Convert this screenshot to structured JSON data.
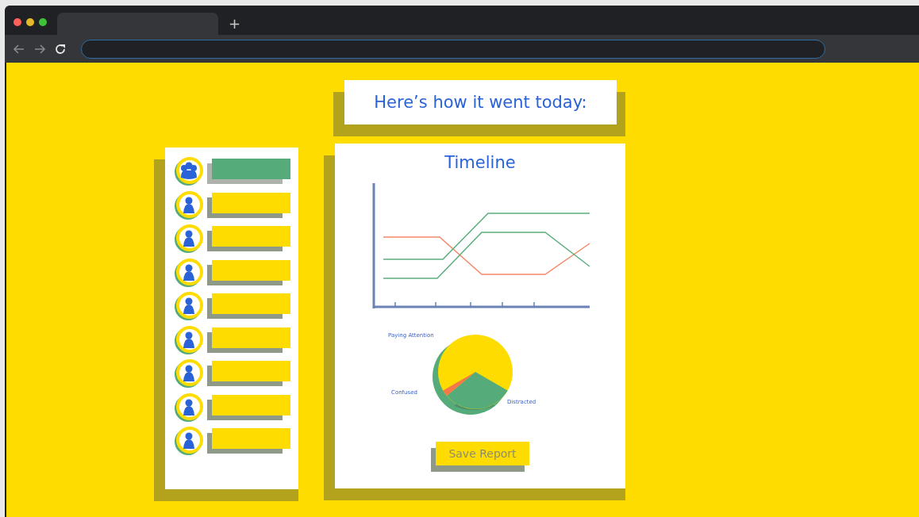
{
  "browser": {
    "new_tab": "+"
  },
  "heading": "Here’s how it went today:",
  "students": [
    {
      "kind": "group",
      "selected": true
    },
    {
      "kind": "person",
      "selected": false
    },
    {
      "kind": "person",
      "selected": false
    },
    {
      "kind": "person",
      "selected": false
    },
    {
      "kind": "person",
      "selected": false
    },
    {
      "kind": "person",
      "selected": false
    },
    {
      "kind": "person",
      "selected": false
    },
    {
      "kind": "person",
      "selected": false
    },
    {
      "kind": "person",
      "selected": false
    }
  ],
  "report": {
    "title": "Timeline",
    "pie_labels": [
      "Paying Attention",
      "Confused",
      "Distracted"
    ],
    "save_button": "Save Report"
  }
}
